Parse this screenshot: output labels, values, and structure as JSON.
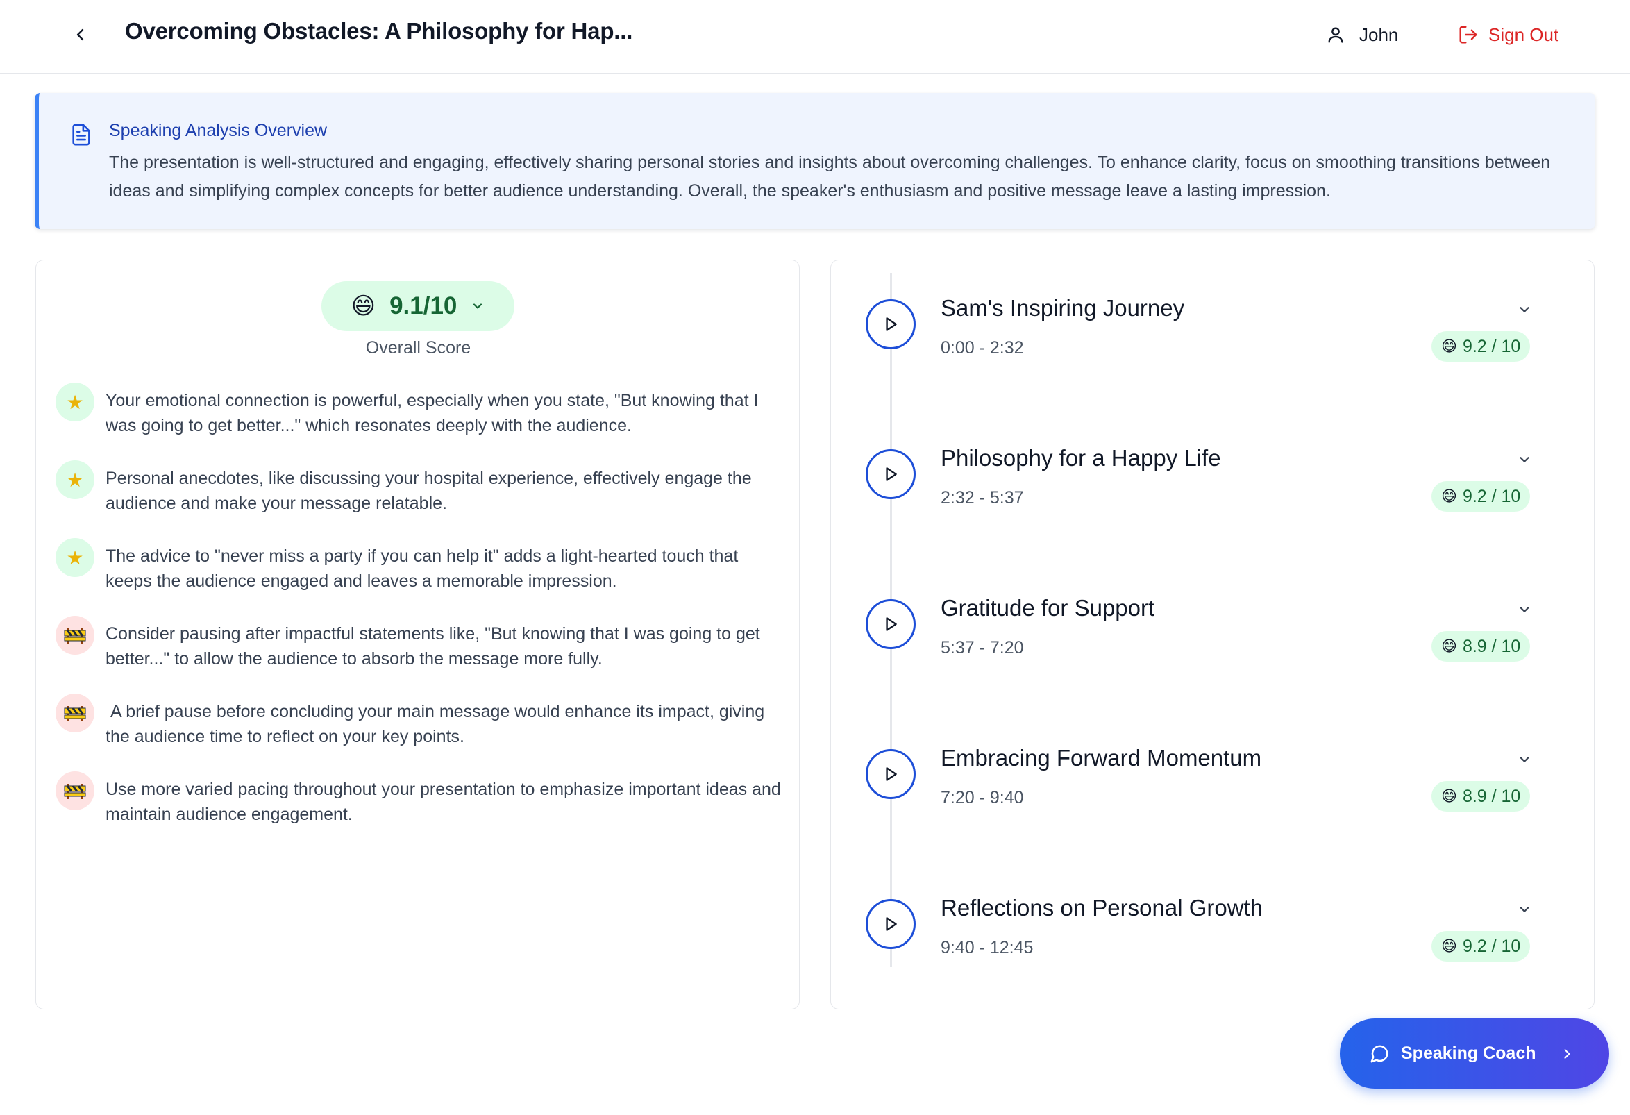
{
  "header": {
    "title": "Overcoming Obstacles: A Philosophy for Hap...",
    "user_name": "John",
    "sign_out_label": "Sign Out",
    "back_icon": "chevron-left-icon",
    "user_icon": "user-icon",
    "sign_out_icon": "log-out-icon"
  },
  "overview": {
    "icon": "document-icon",
    "title": "Speaking Analysis Overview",
    "text": "The presentation is well-structured and engaging, effectively sharing personal stories and insights about overcoming challenges. To enhance clarity, focus on smoothing transitions between ideas and simplifying complex concepts for better audience understanding. Overall, the speaker's enthusiasm and positive message leave a lasting impression."
  },
  "overall": {
    "emoji": "😄",
    "score": "9.1/10",
    "label": "Overall Score"
  },
  "feedback": [
    {
      "type": "strength",
      "icon": "star-icon",
      "text": "Your emotional connection is powerful, especially when you state, \"But knowing that I was going to get better...\" which resonates deeply with the audience."
    },
    {
      "type": "strength",
      "icon": "star-icon",
      "text": "Personal anecdotes, like discussing your hospital experience, effectively engage the audience and make your message relatable."
    },
    {
      "type": "strength",
      "icon": "star-icon",
      "text": "The advice to \"never miss a party if you can help it\" adds a light-hearted touch that keeps the audience engaged and leaves a memorable impression."
    },
    {
      "type": "improvement",
      "icon": "construction-barrier-icon",
      "text": "Consider pausing after impactful statements like, \"But knowing that I was going to get better...\" to allow the audience to absorb the message more fully."
    },
    {
      "type": "improvement",
      "icon": "construction-barrier-icon",
      "text": " A brief pause before concluding your main message would enhance its impact, giving the audience time to reflect on your key points."
    },
    {
      "type": "improvement",
      "icon": "construction-barrier-icon",
      "text": "Use more varied pacing throughout your presentation to emphasize important ideas and maintain audience engagement."
    }
  ],
  "sections": [
    {
      "title": "Sam's Inspiring Journey",
      "time": "0:00 - 2:32",
      "emoji": "😄",
      "score": "9.2 / 10"
    },
    {
      "title": "Philosophy for a Happy Life",
      "time": "2:32 - 5:37",
      "emoji": "😄",
      "score": "9.2 / 10"
    },
    {
      "title": "Gratitude for Support",
      "time": "5:37 - 7:20",
      "emoji": "😄",
      "score": "8.9 / 10"
    },
    {
      "title": "Embracing Forward Momentum",
      "time": "7:20 - 9:40",
      "emoji": "😄",
      "score": "8.9 / 10"
    },
    {
      "title": "Reflections on Personal Growth",
      "time": "9:40 - 12:45",
      "emoji": "😄",
      "score": "9.2 / 10"
    }
  ],
  "coach": {
    "label": "Speaking Coach",
    "icon": "chat-bubble-icon"
  },
  "colors": {
    "accent_blue": "#2563eb",
    "sign_out_red": "#dc2626",
    "score_green_bg": "#dcfce7",
    "score_green_text": "#166534",
    "overview_bg": "#eff4fe"
  }
}
